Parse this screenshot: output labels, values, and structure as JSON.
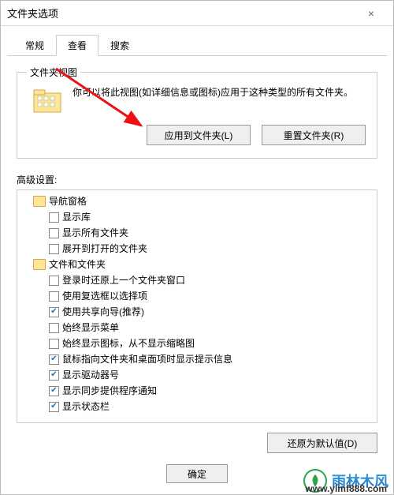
{
  "window": {
    "title": "文件夹选项",
    "close_glyph": "×"
  },
  "tabs": {
    "general": "常规",
    "view": "查看",
    "search": "搜索"
  },
  "folder_view": {
    "legend": "文件夹视图",
    "description": "你可以将此视图(如详细信息或图标)应用于这种类型的所有文件夹。",
    "apply_btn": "应用到文件夹(L)",
    "reset_btn": "重置文件夹(R)"
  },
  "advanced": {
    "label": "高级设置:",
    "items": [
      {
        "type": "group",
        "label": "导航窗格"
      },
      {
        "type": "check",
        "label": "显示库",
        "checked": false,
        "indent": 2
      },
      {
        "type": "check",
        "label": "显示所有文件夹",
        "checked": false,
        "indent": 2
      },
      {
        "type": "check",
        "label": "展开到打开的文件夹",
        "checked": false,
        "indent": 2
      },
      {
        "type": "group",
        "label": "文件和文件夹"
      },
      {
        "type": "check",
        "label": "登录时还原上一个文件夹窗口",
        "checked": false,
        "indent": 2
      },
      {
        "type": "check",
        "label": "使用复选框以选择项",
        "checked": false,
        "indent": 2
      },
      {
        "type": "check",
        "label": "使用共享向导(推荐)",
        "checked": true,
        "indent": 2
      },
      {
        "type": "check",
        "label": "始终显示菜单",
        "checked": false,
        "indent": 2
      },
      {
        "type": "check",
        "label": "始终显示图标，从不显示缩略图",
        "checked": false,
        "indent": 2
      },
      {
        "type": "check",
        "label": "鼠标指向文件夹和桌面项时显示提示信息",
        "checked": true,
        "indent": 2
      },
      {
        "type": "check",
        "label": "显示驱动器号",
        "checked": true,
        "indent": 2
      },
      {
        "type": "check",
        "label": "显示同步提供程序通知",
        "checked": true,
        "indent": 2
      },
      {
        "type": "check",
        "label": "显示状态栏",
        "checked": true,
        "indent": 2
      }
    ],
    "restore_btn": "还原为默认值(D)"
  },
  "dialog": {
    "ok": "确定"
  },
  "watermark": {
    "brand": "雨林木风",
    "url": "www.ylmf888.com"
  }
}
